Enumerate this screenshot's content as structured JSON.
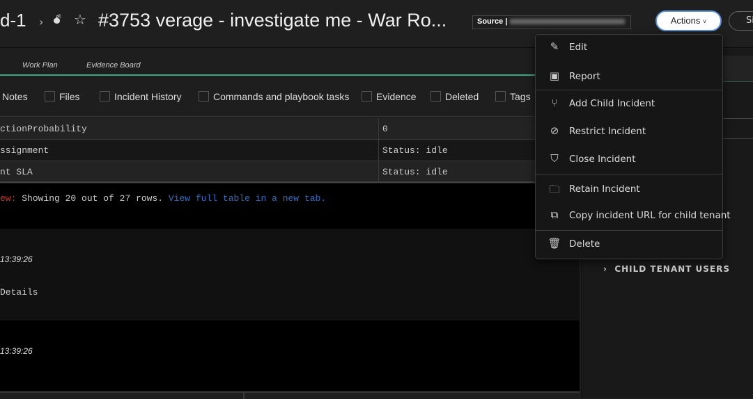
{
  "header": {
    "breadcrumb": "d-1",
    "separator": "›",
    "bomb_icon": "bomb-icon",
    "star_icon": "star-icon",
    "title": "#3753  verage - investigate me - War Ro...",
    "source_label": "Source |",
    "actions_label": "Actions",
    "actions_chevron": "˅",
    "next_button": "Si"
  },
  "tabs": [
    {
      "label": "Work Plan"
    },
    {
      "label": "Evidence Board"
    }
  ],
  "filters": [
    {
      "label": "Notes"
    },
    {
      "label": "Files"
    },
    {
      "label": "Incident History"
    },
    {
      "label": "Commands and playbook tasks"
    },
    {
      "label": "Evidence"
    },
    {
      "label": "Deleted"
    },
    {
      "label": "Tags"
    }
  ],
  "table": {
    "rows": [
      {
        "key": "ctionProbability",
        "value": "0"
      },
      {
        "key": "ssignment",
        "value": "Status: idle"
      },
      {
        "key": "nt SLA",
        "value": "Status: idle"
      }
    ]
  },
  "preview": {
    "prefix": "ew:",
    "text": "Showing 20 out of 27 rows.",
    "link": "View full table in a new tab."
  },
  "entries": [
    {
      "time": "13:39:26",
      "text": "Details"
    },
    {
      "time": "13:39:26"
    }
  ],
  "menu": {
    "items": [
      {
        "label": "Edit",
        "icon": "pencil-icon"
      },
      {
        "label": "Report",
        "icon": "report-icon"
      },
      {
        "label": "Add Child Incident",
        "icon": "branch-icon"
      },
      {
        "label": "Restrict Incident",
        "icon": "restrict-icon"
      },
      {
        "label": "Close Incident",
        "icon": "shield-check-icon"
      },
      {
        "label": "Retain Incident",
        "icon": "folder-lock-icon"
      },
      {
        "label": "Copy incident URL for child tenant",
        "icon": "copy-icon"
      },
      {
        "label": "Delete",
        "icon": "trash-icon"
      }
    ]
  },
  "right_panel": {
    "section": "CHILD TENANT USERS"
  },
  "colors": {
    "accent_green": "#3aa883",
    "link_blue": "#2f6fc2",
    "error_red": "#c0392b"
  }
}
